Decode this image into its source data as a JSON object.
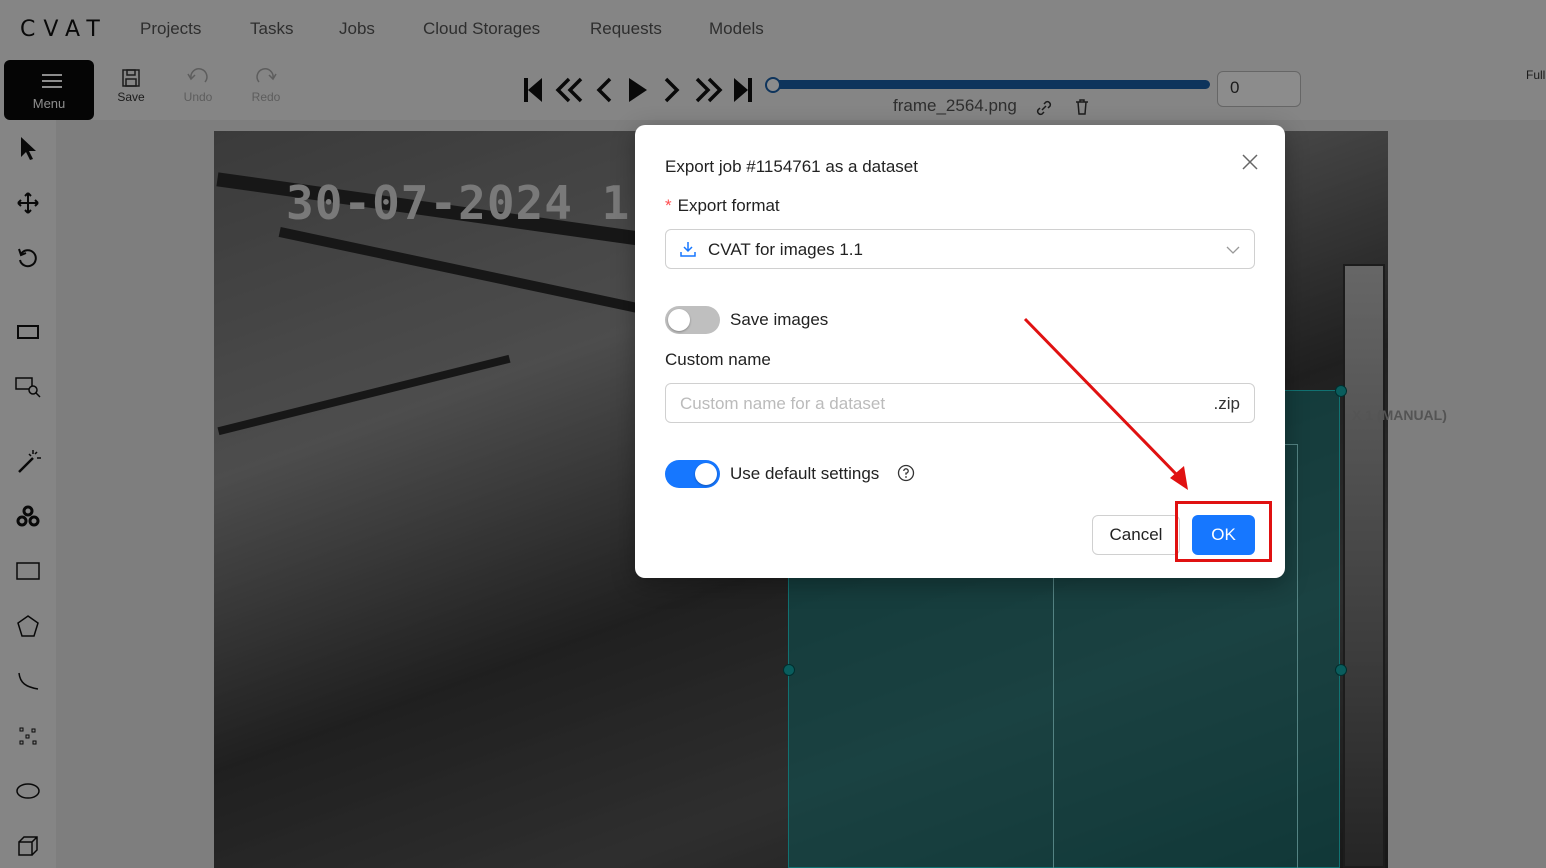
{
  "app": {
    "logo": "CVAT"
  },
  "nav": {
    "items": [
      "Projects",
      "Tasks",
      "Jobs",
      "Cloud Storages",
      "Requests",
      "Models"
    ]
  },
  "toolbar": {
    "menu_label": "Menu",
    "save_label": "Save",
    "undo_label": "Undo",
    "redo_label": "Redo",
    "frame_number": "0",
    "frame_name": "frame_2564.png",
    "fullscreen_label": "Full"
  },
  "canvas": {
    "timestamp": "30-07-2024 1",
    "object_label": "X 1 (MANUAL)"
  },
  "dialog": {
    "title": "Export job #1154761 as a dataset",
    "required_mark": "*",
    "export_format_label": "Export format",
    "export_format_value": "CVAT for images 1.1",
    "save_images_label": "Save images",
    "save_images_on": false,
    "custom_name_label": "Custom name",
    "custom_name_placeholder": "Custom name for a dataset",
    "custom_name_suffix": ".zip",
    "use_default_label": "Use default settings",
    "use_default_on": true,
    "cancel_label": "Cancel",
    "ok_label": "OK"
  },
  "colors": {
    "primary": "#1677ff",
    "annotation_red": "#e01111",
    "bbox": "#1fd0d0"
  }
}
